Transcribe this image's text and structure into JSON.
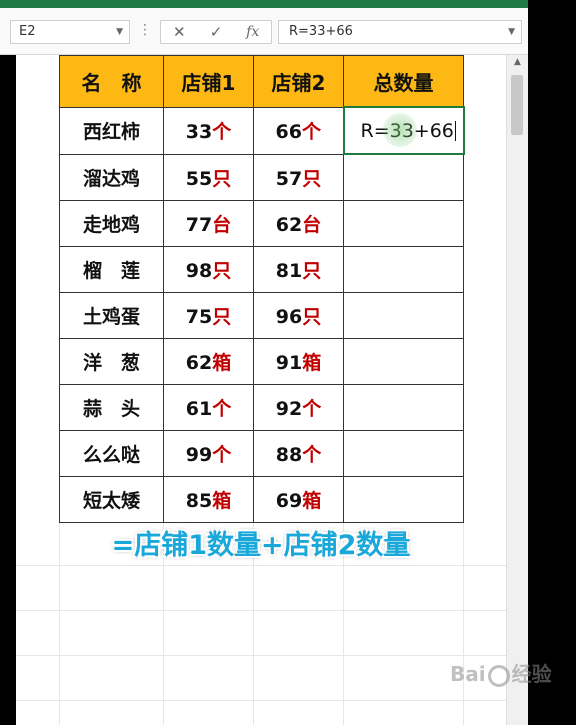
{
  "namebox": {
    "value": "E2"
  },
  "formula_bar": {
    "value": "R=33+66",
    "fx_label": "fx"
  },
  "table": {
    "headers": [
      "名　称",
      "店铺1",
      "店铺2",
      "总数量"
    ],
    "rows": [
      {
        "name": "西红柿",
        "s1": "33",
        "u1": "个",
        "s2": "66",
        "u2": "个"
      },
      {
        "name": "溜达鸡",
        "s1": "55",
        "u1": "只",
        "s2": "57",
        "u2": "只"
      },
      {
        "name": "走地鸡",
        "s1": "77",
        "u1": "台",
        "s2": "62",
        "u2": "台"
      },
      {
        "name": "榴　莲",
        "s1": "98",
        "u1": "只",
        "s2": "81",
        "u2": "只"
      },
      {
        "name": "土鸡蛋",
        "s1": "75",
        "u1": "只",
        "s2": "96",
        "u2": "只"
      },
      {
        "name": "洋　葱",
        "s1": "62",
        "u1": "箱",
        "s2": "91",
        "u2": "箱"
      },
      {
        "name": "蒜　头",
        "s1": "61",
        "u1": "个",
        "s2": "92",
        "u2": "个"
      },
      {
        "name": "么么哒",
        "s1": "99",
        "u1": "个",
        "s2": "88",
        "u2": "个"
      },
      {
        "name": "短太矮",
        "s1": "85",
        "u1": "箱",
        "s2": "69",
        "u2": "箱"
      }
    ],
    "editing_cell": "R=33+66"
  },
  "caption": "=店铺1数量+店铺2数量",
  "watermark": {
    "left": "Bai",
    "right": "经验"
  },
  "colors": {
    "header_bg": "#fdb813",
    "unit_text": "#c00000",
    "caption": "#1aa7d9",
    "active_border": "#1e7b3e"
  }
}
